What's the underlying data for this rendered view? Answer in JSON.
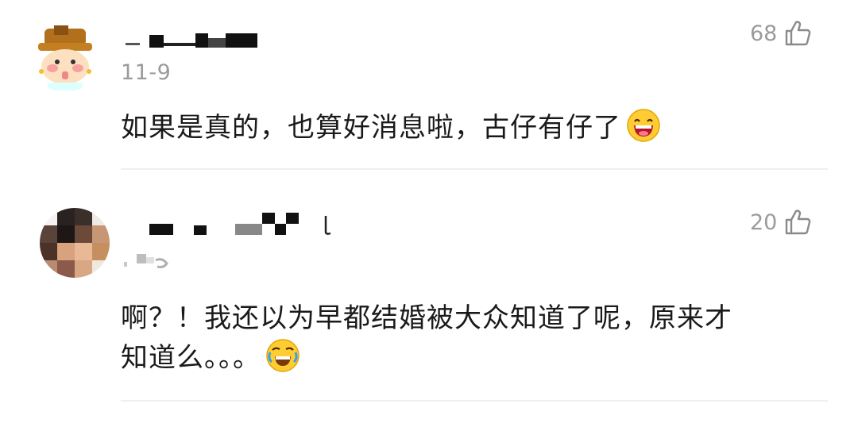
{
  "comments": [
    {
      "date": "11-9",
      "likes": "68",
      "text": "如果是真的，也算好消息啦，古仔有仔了",
      "emoji": "laughing-face-icon"
    },
    {
      "date": "",
      "likes": "20",
      "text_line1": "啊？！我还以为早都结婚被大众知道了呢，原来才",
      "text_line2": "知道么。。。",
      "emoji": "rolling-on-floor-laughing-icon"
    }
  ],
  "colors": {
    "meta_gray": "#9b9b9b",
    "divider": "#efefef",
    "text": "#1a1a1a"
  }
}
